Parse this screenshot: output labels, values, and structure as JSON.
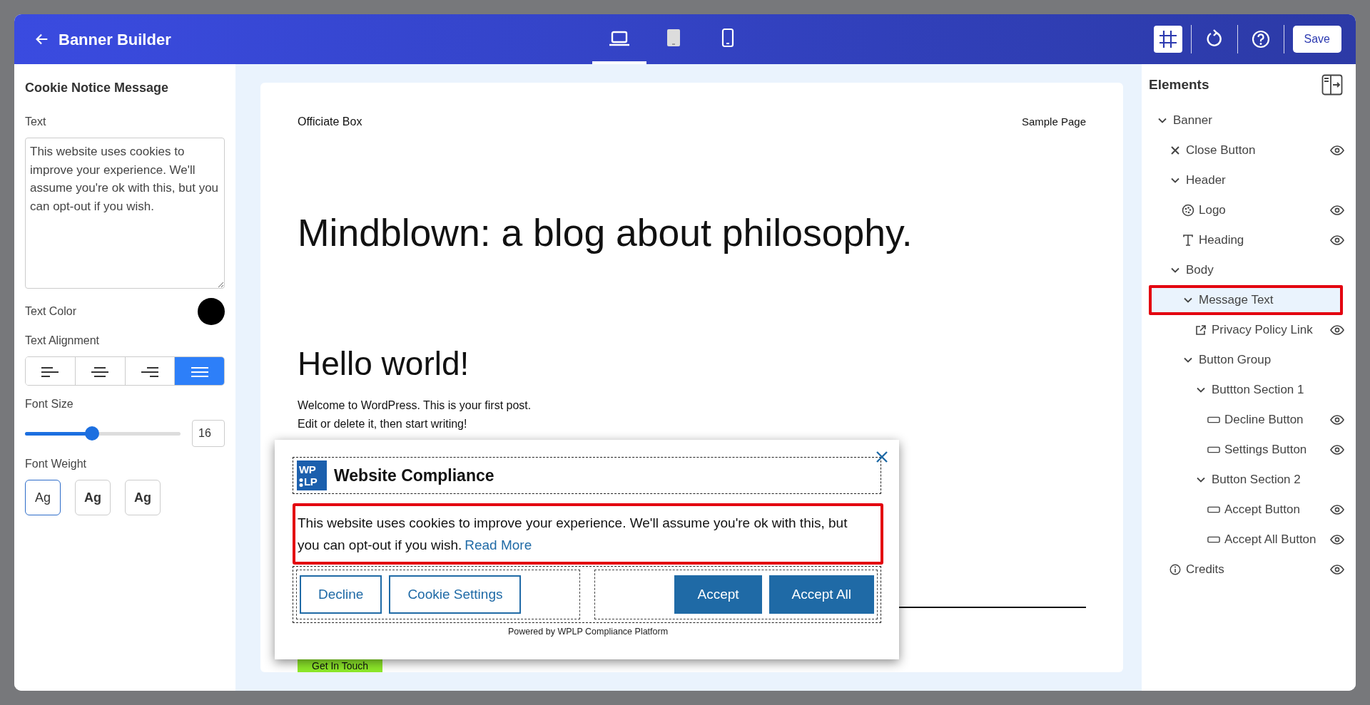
{
  "header": {
    "title": "Banner Builder",
    "device_tabs": [
      {
        "kind": "laptop",
        "selected": true
      },
      {
        "kind": "tablet",
        "selected": false
      },
      {
        "kind": "phone",
        "selected": false
      }
    ],
    "tools": [
      {
        "kind": "grid",
        "selected": true
      },
      {
        "kind": "reset",
        "selected": false
      },
      {
        "kind": "help",
        "selected": false
      }
    ],
    "save": "Save"
  },
  "left_panel": {
    "title": "Cookie Notice Message",
    "text_label": "Text",
    "text_value": "This website uses cookies to improve your experience. We'll assume you're ok with this, but you can opt-out if you wish.",
    "text_color_label": "Text Color",
    "text_color": {
      "color": "#000000"
    },
    "alignment_label": "Text Alignment",
    "alignments": [
      {
        "kind": "left",
        "selected": false
      },
      {
        "kind": "center",
        "selected": false
      },
      {
        "kind": "right",
        "selected": false
      },
      {
        "kind": "justify",
        "selected": true
      }
    ],
    "font_size_label": "Font Size",
    "font_size": {
      "level": 0.43,
      "value": "16"
    },
    "font_weight_label": "Font Weight",
    "weights": [
      {
        "label": "Ag",
        "kind": "normal",
        "selected": true
      },
      {
        "label": "Ag",
        "kind": "medium",
        "selected": false
      },
      {
        "label": "Ag",
        "kind": "bold",
        "selected": false
      }
    ]
  },
  "preview": {
    "site_title": "Officiate Box",
    "nav_link": "Sample Page",
    "hero": "Mindblown: a blog about philosophy.",
    "post_title": "Hello world!",
    "post_lines": [
      "Welcome to WordPress. This is your first post.",
      "Edit or delete it, then start writing!"
    ],
    "cta": "Get In Touch",
    "banner": {
      "logo_lines": [
        "WP",
        "LP"
      ],
      "heading": "Website Compliance",
      "message": "This website uses cookies to improve your experience. We'll assume you're ok with this, but you can opt-out if you wish.",
      "message_highlighted": true,
      "link": "Read More",
      "sections": [
        {
          "buttons": [
            {
              "label": "Decline",
              "kind": "outline"
            },
            {
              "label": "Cookie Settings",
              "kind": "outline"
            }
          ]
        },
        {
          "buttons": [
            {
              "label": "Accept",
              "kind": "filled"
            },
            {
              "label": "Accept All",
              "kind": "filled"
            }
          ]
        }
      ],
      "powered_by": "Powered by",
      "powered_link": "WPLP Compliance Platform"
    }
  },
  "elements": {
    "title": "Elements",
    "tree": [
      {
        "label": "Banner",
        "kind": "group",
        "selected": false,
        "children": [
          {
            "label": "Close Button",
            "kind": "close",
            "visible": true,
            "selected": false
          },
          {
            "label": "Header",
            "kind": "group",
            "selected": false,
            "children": [
              {
                "label": "Logo",
                "kind": "logo",
                "visible": true,
                "selected": false
              },
              {
                "label": "Heading",
                "kind": "heading",
                "visible": true,
                "selected": false
              }
            ]
          },
          {
            "label": "Body",
            "kind": "group",
            "selected": false,
            "children": [
              {
                "label": "Message Text",
                "kind": "group",
                "selected": true,
                "children": [
                  {
                    "label": "Privacy Policy Link",
                    "kind": "link",
                    "visible": true,
                    "selected": false
                  }
                ]
              },
              {
                "label": "Button Group",
                "kind": "group",
                "selected": false,
                "children": [
                  {
                    "label": "Buttton Section 1",
                    "kind": "group",
                    "selected": false,
                    "children": [
                      {
                        "label": "Decline Button",
                        "kind": "button",
                        "visible": true,
                        "selected": false
                      },
                      {
                        "label": "Settings Button",
                        "kind": "button",
                        "visible": true,
                        "selected": false
                      }
                    ]
                  },
                  {
                    "label": "Button Section 2",
                    "kind": "group",
                    "selected": false,
                    "children": [
                      {
                        "label": "Accept Button",
                        "kind": "button",
                        "visible": true,
                        "selected": false
                      },
                      {
                        "label": "Accept All Button",
                        "kind": "button",
                        "visible": true,
                        "selected": false
                      }
                    ]
                  }
                ]
              }
            ]
          },
          {
            "label": "Credits",
            "kind": "credits",
            "visible": true,
            "selected": false
          }
        ]
      }
    ]
  }
}
